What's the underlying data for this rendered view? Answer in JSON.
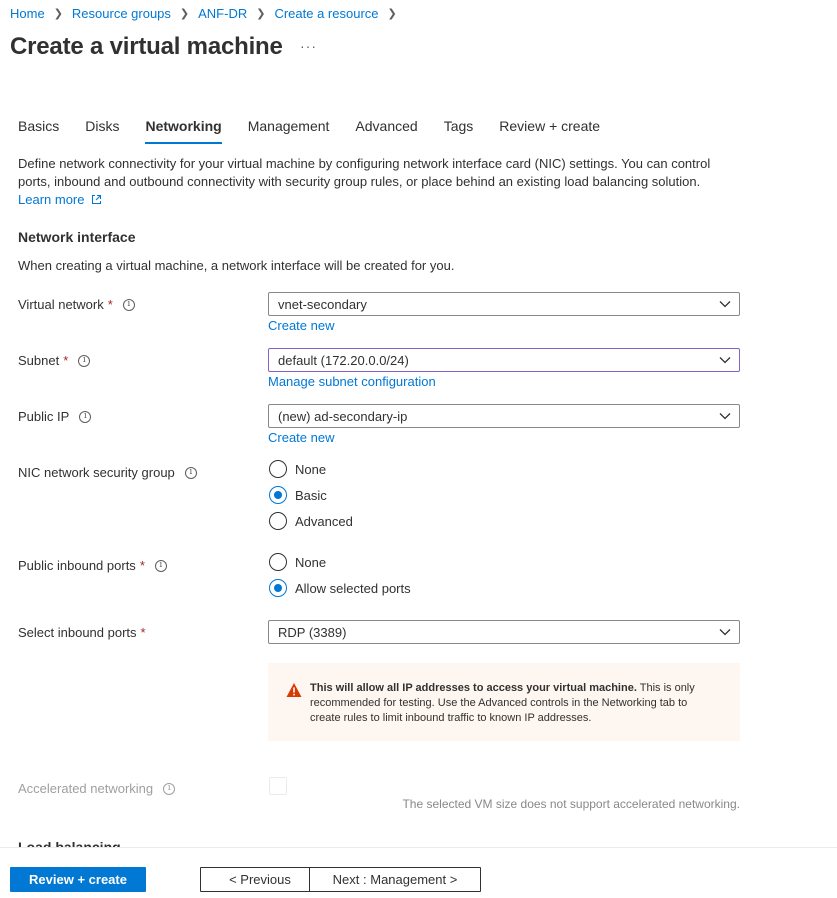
{
  "breadcrumb": [
    "Home",
    "Resource groups",
    "ANF-DR",
    "Create a resource"
  ],
  "title": "Create a virtual machine",
  "more_label": "···",
  "tabs": [
    "Basics",
    "Disks",
    "Networking",
    "Management",
    "Advanced",
    "Tags",
    "Review + create"
  ],
  "active_tab": "Networking",
  "intro": {
    "text": "Define network connectivity for your virtual machine by configuring network interface card (NIC) settings. You can control ports, inbound and outbound connectivity with security group rules, or place behind an existing load balancing solution.",
    "learn_more": "Learn more"
  },
  "network_interface": {
    "heading": "Network interface",
    "description": "When creating a virtual machine, a network interface will be created for you."
  },
  "fields": {
    "virtual_network": {
      "label": "Virtual network",
      "value": "vnet-secondary",
      "link": "Create new"
    },
    "subnet": {
      "label": "Subnet",
      "value": "default (172.20.0.0/24)",
      "link": "Manage subnet configuration"
    },
    "public_ip": {
      "label": "Public IP",
      "value": "(new) ad-secondary-ip",
      "link": "Create new"
    },
    "nic_nsg": {
      "label": "NIC network security group",
      "options": [
        "None",
        "Basic",
        "Advanced"
      ],
      "selected": "Basic"
    },
    "public_inbound_ports": {
      "label": "Public inbound ports",
      "options": [
        "None",
        "Allow selected ports"
      ],
      "selected": "Allow selected ports"
    },
    "select_inbound_ports": {
      "label": "Select inbound ports",
      "value": "RDP (3389)"
    },
    "accelerated_networking": {
      "label": "Accelerated networking",
      "checked": false,
      "disabled": true,
      "note": "The selected VM size does not support accelerated networking."
    }
  },
  "required_marker": "*",
  "info_glyph": "i",
  "warning": {
    "bold": "This will allow all IP addresses to access your virtual machine.",
    "text": "This is only recommended for testing.  Use the Advanced controls in the Networking tab to create rules to limit inbound traffic to known IP addresses."
  },
  "next_section_heading": "Load balancing",
  "footer": {
    "review_create": "Review + create",
    "previous": "< Previous",
    "next": "Next : Management >"
  },
  "colors": {
    "accent": "#0078d4",
    "required": "#a4262c",
    "warning_bg": "#fdf6f1",
    "warning_icon": "#d83b01"
  }
}
